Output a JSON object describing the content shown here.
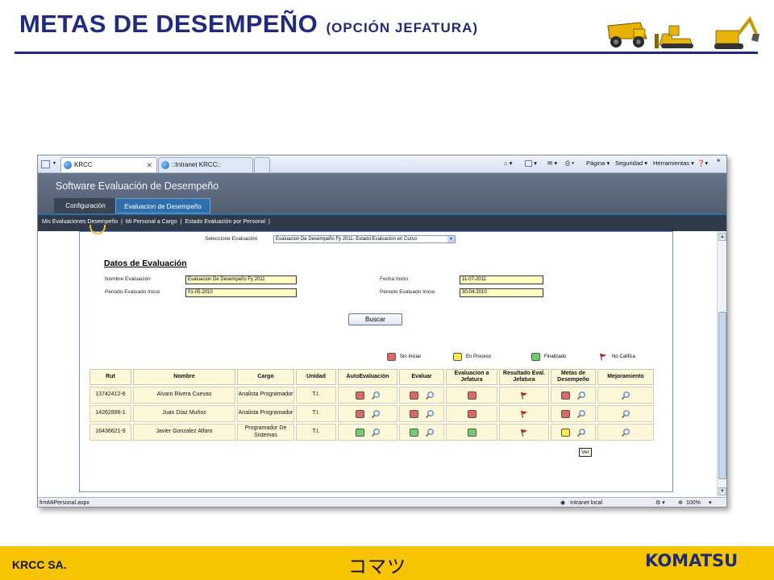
{
  "slide": {
    "title": "METAS DE DESEMPEÑO",
    "subtitle": "(OPCIÓN JEFATURA)",
    "footer_left": "KRCC SA.",
    "footer_center": "コマツ",
    "footer_logo": "KOMATSU",
    "accent_color": "#1f2a80",
    "footer_color": "#f6c400"
  },
  "browser": {
    "tabs": [
      {
        "label": "KRCC",
        "close": "✕"
      },
      {
        "label": "::Intranet KRCC::"
      }
    ],
    "commands": {
      "page": "Página",
      "security": "Seguridad",
      "tools": "Herramientas"
    },
    "status_url": "frmMiPersonal.aspx",
    "status_zone": "Intranet local",
    "zoom": "100%"
  },
  "app": {
    "title": "Software Evaluación de Desempeño",
    "tabs": [
      "Configuración",
      "Evaluacion de Desempeño"
    ],
    "nav_links": [
      "Mis Evaluaciones Desempeño",
      "Mi Personal a Cargo",
      "Estado Evaluación por Personal"
    ],
    "nav_separator": "|"
  },
  "form": {
    "select_label": "Seleccione Evaluación",
    "select_value": "Evaluacion De Desempeño Fy 2011- Estado:Evaluacion en Curso",
    "section_title": "Datos de Evaluación",
    "nombre_label": "Nombre Evaluación",
    "nombre_value": "Evaluacion De Desempeño Fy 2011",
    "periodo_label": "Periodo Evaluado Inicio",
    "periodo_value": "01-05-2010",
    "fecha_label": "Fecha Inicio",
    "fecha_value": "11-07-2011",
    "periodo_fin_label": "Periodo Evaluado Inicio",
    "periodo_fin_value": "30-04-2010",
    "search_button": "Buscar"
  },
  "legend": [
    {
      "label": "Sin Iniciar",
      "color": "#e06666"
    },
    {
      "label": "En Proceso",
      "color": "#ffe94a"
    },
    {
      "label": "Finalizado",
      "color": "#6fcf6f"
    },
    {
      "label": "No Califica",
      "icon": "red-flag-icon"
    }
  ],
  "table": {
    "headers": [
      "Rut",
      "Nombre",
      "Cargo",
      "Unidad",
      "AutoEvaluación",
      "Evaluar",
      "Evaluacion a Jefatura",
      "Resultado Eval. Jefatura",
      "Metas de Desempeño",
      "Mejoramiento"
    ],
    "rows": [
      {
        "rut": "13742412-6",
        "nombre": "Alvaro Rivera Cuevas",
        "cargo": "Analista Programador",
        "unidad": "T.I.",
        "auto": "red",
        "evaluar": "red",
        "jefatura": "red",
        "resultado": "flag",
        "metas": "red"
      },
      {
        "rut": "14262896-1",
        "nombre": "Juan Díaz Muñoz",
        "cargo": "Analista Programador",
        "unidad": "T.I.",
        "auto": "red",
        "evaluar": "red",
        "jefatura": "red",
        "resultado": "flag",
        "metas": "red"
      },
      {
        "rut": "16436621-9",
        "nombre": "Javier Gonzalez Alfaro",
        "cargo": "Programador De Sistemas",
        "unidad": "T.I.",
        "auto": "green",
        "evaluar": "green",
        "jefatura": "green",
        "resultado": "flag",
        "metas": "yellow"
      }
    ],
    "tooltip": "Ver"
  }
}
